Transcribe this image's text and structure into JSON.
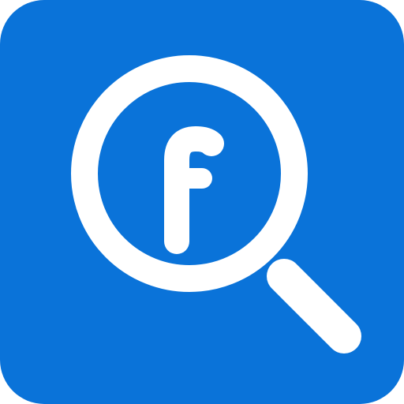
{
  "icon": {
    "name": "facebook-search-icon",
    "glyph": "f",
    "colors": {
      "background": "#0A73D9",
      "foreground": "#FFFFFF"
    }
  }
}
